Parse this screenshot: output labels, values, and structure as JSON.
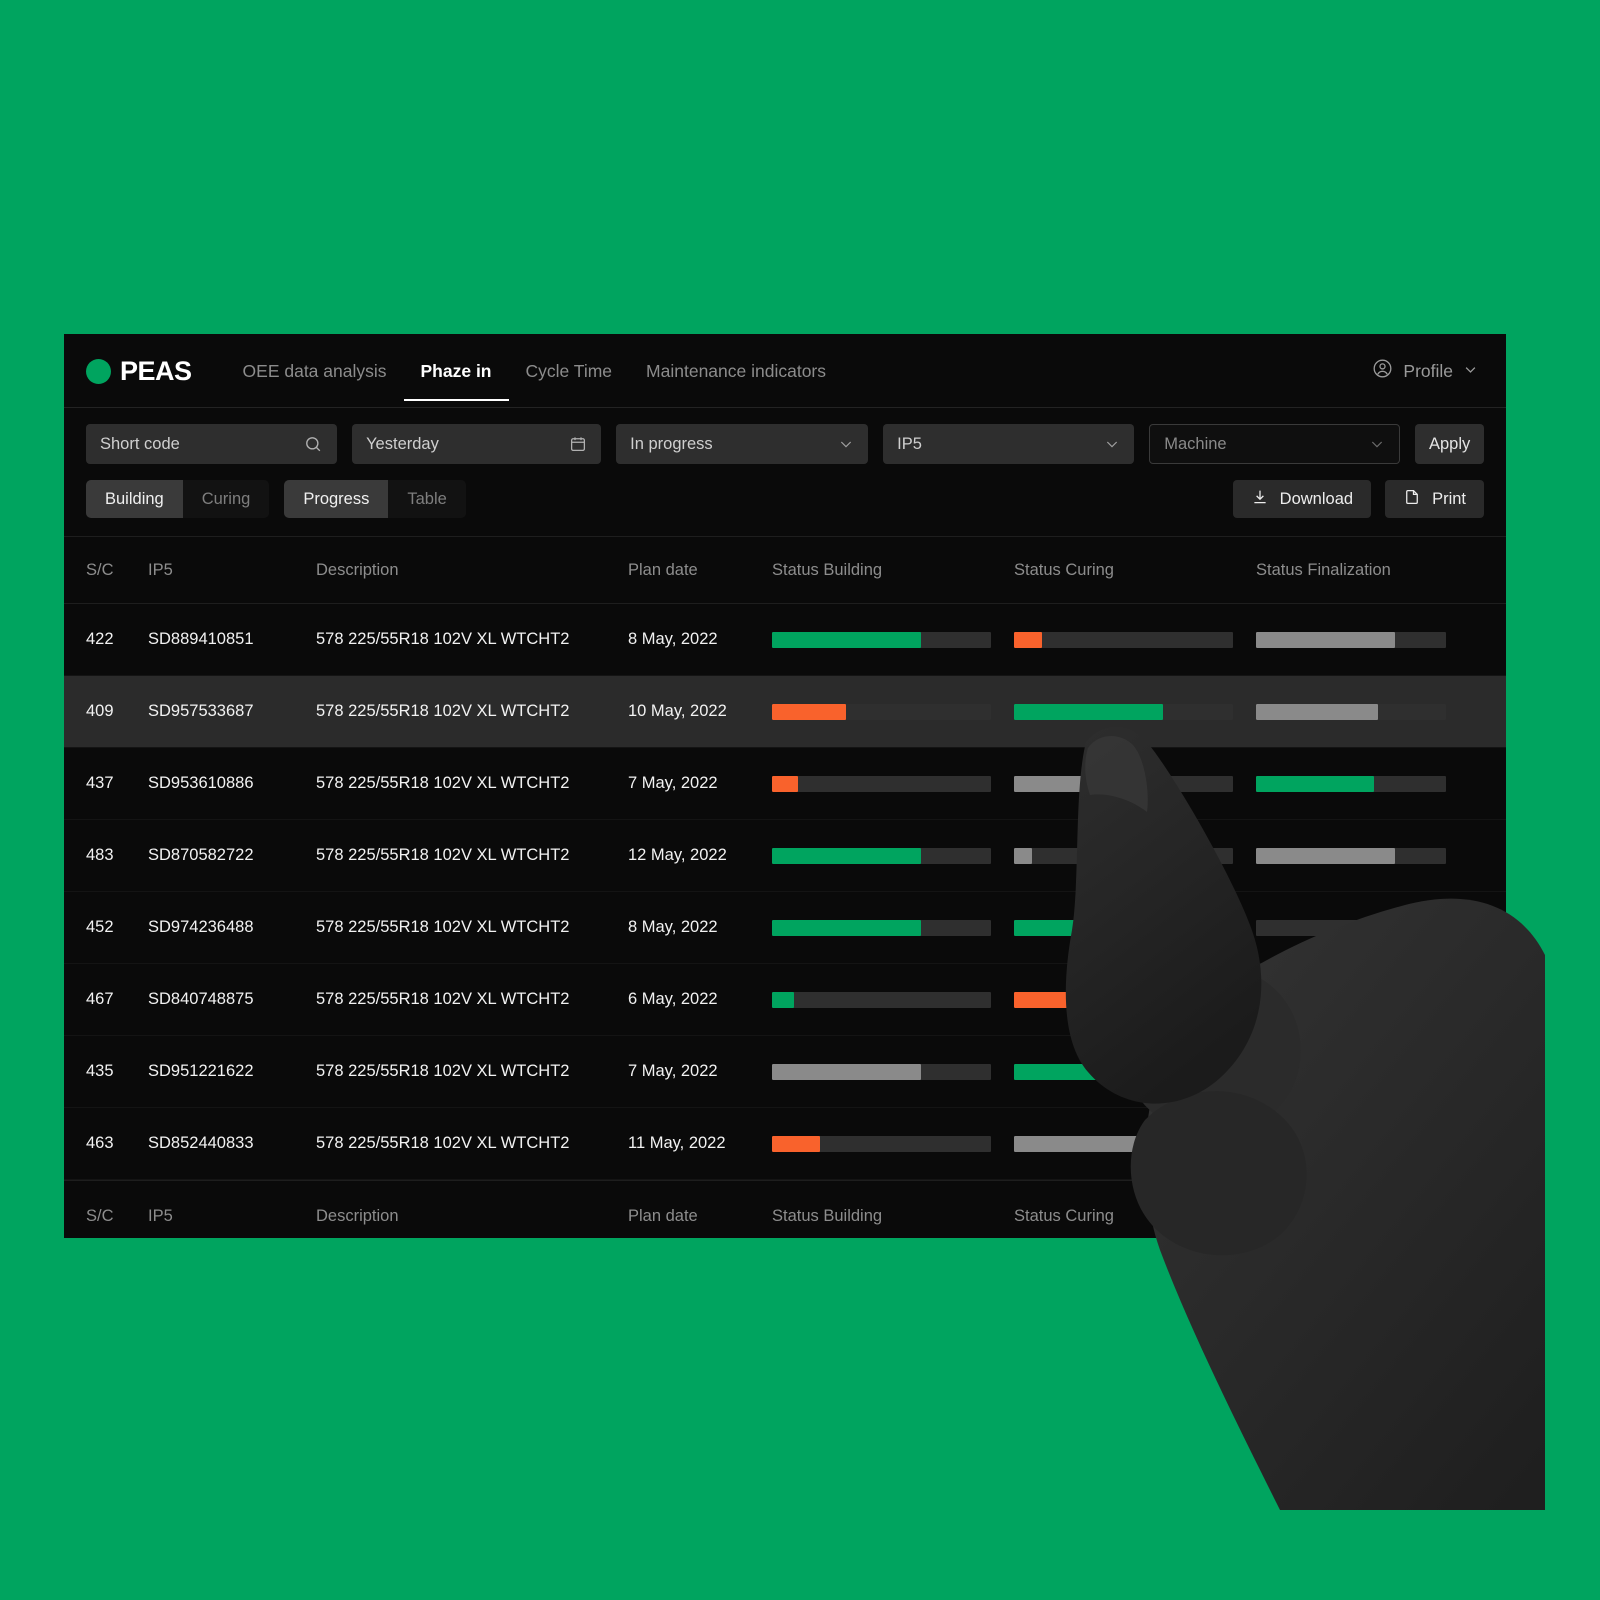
{
  "app": {
    "brand": "PEAS",
    "brand_dot_color": "#00a45f",
    "background": "#00a45f",
    "surface": "#0a0a0a"
  },
  "nav": {
    "links": [
      {
        "label": "OEE data analysis",
        "active": false
      },
      {
        "label": "Phaze in",
        "active": true
      },
      {
        "label": "Cycle Time",
        "active": false
      },
      {
        "label": "Maintenance indicators",
        "active": false
      }
    ],
    "profile_label": "Profile",
    "profile_icon": "user-circle-icon",
    "profile_chevron": "chevron-down-icon"
  },
  "filters": {
    "short_code": {
      "placeholder": "Short code",
      "value": "",
      "icon": "search-icon"
    },
    "date": {
      "value": "Yesterday",
      "icon": "calendar-icon"
    },
    "status": {
      "value": "In progress",
      "icon": "chevron-down-icon"
    },
    "ip5": {
      "value": "IP5",
      "icon": "chevron-down-icon"
    },
    "machine": {
      "value": "Machine",
      "icon": "chevron-down-icon"
    },
    "apply_label": "Apply"
  },
  "controls": {
    "phase_toggle": [
      {
        "label": "Building",
        "selected": true
      },
      {
        "label": "Curing",
        "selected": false
      }
    ],
    "view_toggle": [
      {
        "label": "Progress",
        "selected": true
      },
      {
        "label": "Table",
        "selected": false
      }
    ],
    "download_label": "Download",
    "download_icon": "download-icon",
    "print_label": "Print",
    "print_icon": "print-page-icon"
  },
  "table": {
    "columns": [
      "S/C",
      "IP5",
      "Description",
      "Plan date",
      "Status Building",
      "Status Curing",
      "Status Finalization"
    ],
    "footer_columns": [
      "S/C",
      "IP5",
      "Description",
      "Plan date",
      "Status Building",
      "Status Curing"
    ],
    "colors": {
      "green": "#00a45f",
      "orange": "#f9622c",
      "grey": "#8a8a8a",
      "track": "#2f2f2f"
    },
    "rows": [
      {
        "sc": "422",
        "ip5": "SD889410851",
        "description": "578 225/55R18 102V XL WTCHT2",
        "plan_date": "8 May, 2022",
        "selected": false,
        "building": {
          "percent": 68,
          "color": "#00a45f"
        },
        "curing": {
          "percent": 13,
          "color": "#f9622c"
        },
        "finalization": {
          "percent": 73,
          "color": "#8a8a8a"
        }
      },
      {
        "sc": "409",
        "ip5": "SD957533687",
        "description": "578 225/55R18 102V XL WTCHT2",
        "plan_date": "10 May, 2022",
        "selected": true,
        "building": {
          "percent": 34,
          "color": "#f9622c"
        },
        "curing": {
          "percent": 68,
          "color": "#00a45f"
        },
        "finalization": {
          "percent": 64,
          "color": "#8a8a8a"
        }
      },
      {
        "sc": "437",
        "ip5": "SD953610886",
        "description": "578 225/55R18 102V XL WTCHT2",
        "plan_date": "7 May, 2022",
        "selected": false,
        "building": {
          "percent": 12,
          "color": "#f9622c"
        },
        "curing": {
          "percent": 36,
          "color": "#8a8a8a"
        },
        "finalization": {
          "percent": 62,
          "color": "#00a45f"
        }
      },
      {
        "sc": "483",
        "ip5": "SD870582722",
        "description": "578 225/55R18 102V XL WTCHT2",
        "plan_date": "12 May, 2022",
        "selected": false,
        "building": {
          "percent": 68,
          "color": "#00a45f"
        },
        "curing": {
          "percent": 8,
          "color": "#8a8a8a"
        },
        "finalization": {
          "percent": 73,
          "color": "#8a8a8a"
        }
      },
      {
        "sc": "452",
        "ip5": "SD974236488",
        "description": "578 225/55R18 102V XL WTCHT2",
        "plan_date": "8 May, 2022",
        "selected": false,
        "building": {
          "percent": 68,
          "color": "#00a45f"
        },
        "curing": {
          "percent": 68,
          "color": "#00a45f"
        },
        "finalization": {
          "percent": 0,
          "color": "#8a8a8a"
        }
      },
      {
        "sc": "467",
        "ip5": "SD840748875",
        "description": "578 225/55R18 102V XL WTCHT2",
        "plan_date": "6 May, 2022",
        "selected": false,
        "building": {
          "percent": 10,
          "color": "#00a45f"
        },
        "curing": {
          "percent": 45,
          "color": "#f9622c"
        },
        "finalization": {
          "percent": 0,
          "color": "#8a8a8a"
        }
      },
      {
        "sc": "435",
        "ip5": "SD951221622",
        "description": "578 225/55R18 102V XL WTCHT2",
        "plan_date": "7 May, 2022",
        "selected": false,
        "building": {
          "percent": 68,
          "color": "#8a8a8a"
        },
        "curing": {
          "percent": 45,
          "color": "#00a45f"
        },
        "finalization": {
          "percent": 0,
          "color": "#8a8a8a"
        }
      },
      {
        "sc": "463",
        "ip5": "SD852440833",
        "description": "578 225/55R18 102V XL WTCHT2",
        "plan_date": "11 May, 2022",
        "selected": false,
        "building": {
          "percent": 22,
          "color": "#f9622c"
        },
        "curing": {
          "percent": 62,
          "color": "#8a8a8a"
        },
        "finalization": {
          "percent": 0,
          "color": "#8a8a8a"
        }
      }
    ]
  }
}
